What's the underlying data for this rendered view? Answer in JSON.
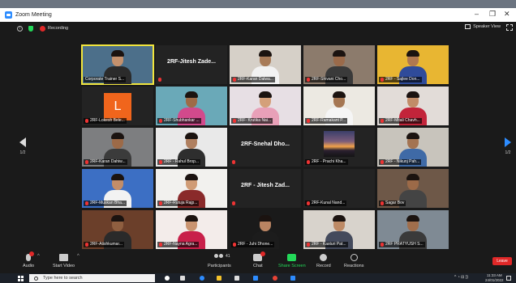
{
  "window": {
    "title": "Zoom Meeting",
    "minimize": "–",
    "maximize": "❐",
    "close": "✕"
  },
  "meeting_bar": {
    "recording": "Recording",
    "speaker_view": "Speaker View"
  },
  "nav": {
    "left_page": "1/2",
    "right_page": "1/2"
  },
  "tiles": [
    {
      "label": "Corporate Trainer S...",
      "big": "",
      "active": true,
      "kind": "photo",
      "bg": "#4c6f8a",
      "skin": "#c4916d",
      "shirt": "#2b2b2b",
      "hair": true
    },
    {
      "label": "",
      "big": "2RF-Jitesh Zade...",
      "kind": "name"
    },
    {
      "label": "2RF-Karan Dalwa...",
      "big": "",
      "kind": "photo",
      "bg": "#d6d0c8",
      "skin": "#a87b58",
      "shirt": "#f2f2f2",
      "hair": true
    },
    {
      "label": "2RF-Shivani Cho...",
      "big": "",
      "kind": "photo",
      "bg": "#8c7b6c",
      "skin": "#9a6a4a",
      "shirt": "#3a3a3a",
      "hair": true
    },
    {
      "label": "2RF - Sajlee Don...",
      "big": "",
      "kind": "photo",
      "bg": "#e8b632",
      "skin": "#b07850",
      "shirt": "#2f4b9a",
      "hair": true
    },
    {
      "label": "2RF-Lokesh Bele...",
      "big": "",
      "kind": "letter",
      "letter": "L"
    },
    {
      "label": "2RF-Shubhankar ...",
      "big": "",
      "kind": "photo",
      "bg": "#6aa9b8",
      "skin": "#9e6b47",
      "shirt": "#d24a8c",
      "hair": true
    },
    {
      "label": "2RF- Krutika Nai...",
      "big": "",
      "kind": "photo",
      "bg": "#e7dfe4",
      "skin": "#d4a07a",
      "shirt": "#e8a0b8",
      "hair": true
    },
    {
      "label": "2RF-Ramakant P...",
      "big": "",
      "kind": "photo",
      "bg": "#ece9e2",
      "skin": "#a57652",
      "shirt": "#f5f5f5",
      "hair": true
    },
    {
      "label": "2RF-Mitali Chavh...",
      "big": "",
      "kind": "photo",
      "bg": "#e2dcd8",
      "skin": "#c18c68",
      "shirt": "#c2243a",
      "hair": true
    },
    {
      "label": "2RF-Karan Dahiw...",
      "big": "",
      "kind": "photo",
      "bg": "#7d7e80",
      "skin": "#9c6a48",
      "shirt": "#3b3b3b",
      "hair": true
    },
    {
      "label": "2RF - Rahul Brop...",
      "big": "",
      "kind": "photo",
      "bg": "#e9e9e9",
      "skin": "#b08060",
      "shirt": "#2e2e2e",
      "hair": true
    },
    {
      "label": "",
      "big": "2RF-Snehal Dho...",
      "kind": "name"
    },
    {
      "label": "2RF - Prachi Kha...",
      "big": "",
      "kind": "sunset"
    },
    {
      "label": "2RF - Nikunj Pah...",
      "big": "",
      "kind": "photo",
      "bg": "#c8c4bc",
      "skin": "#a47452",
      "shirt": "#3f6aa6",
      "hair": true
    },
    {
      "label": "2RF-Muskan Bha...",
      "big": "",
      "kind": "photo",
      "bg": "#3c6fc4",
      "skin": "#c28d68",
      "shirt": "#f2f2f2",
      "hair": true
    },
    {
      "label": "2RF-Rutuja Rajp...",
      "big": "",
      "kind": "photo",
      "bg": "#f2f1ee",
      "skin": "#d09c76",
      "shirt": "#8a2a2a",
      "hair": true
    },
    {
      "label": "",
      "big": "2RF - Jitesh Zad...",
      "kind": "name"
    },
    {
      "label": "2RF-Kunal Nand...",
      "big": "",
      "kind": "blank"
    },
    {
      "label": "Sagar Bov",
      "big": "",
      "kind": "photo",
      "bg": "#6e5848",
      "skin": "#9c6a48",
      "shirt": "#444444",
      "hair": true
    },
    {
      "label": "2RF-Atishkumar...",
      "big": "",
      "kind": "photo",
      "bg": "#6b3f2a",
      "skin": "#8f5f40",
      "shirt": "#2a2a2a",
      "hair": true
    },
    {
      "label": "2RF-Nayna Agra...",
      "big": "",
      "kind": "photo",
      "bg": "#f3ecea",
      "skin": "#c99470",
      "shirt": "#c8204a",
      "hair": true
    },
    {
      "label": "2RF - Juhi Dhone...",
      "big": "",
      "kind": "photo",
      "bg": "#1a1a1a",
      "skin": "#b98462",
      "shirt": "#1c1c1c",
      "hair": true
    },
    {
      "label": "2RF - Kasturi Pat...",
      "big": "",
      "kind": "photo",
      "bg": "#d8d3cc",
      "skin": "#bd8a66",
      "shirt": "#444a5c",
      "hair": true
    },
    {
      "label": "2RF PRATYUSH S...",
      "big": "",
      "kind": "photo",
      "bg": "#7f8a94",
      "skin": "#a06e4c",
      "shirt": "#3a3a3a",
      "hair": true
    }
  ],
  "toolbar": {
    "audio": "Audio",
    "video": "Start Video",
    "participants": "Participants",
    "participants_count": "41",
    "chat": "Chat",
    "share": "Share Screen",
    "record": "Record",
    "reactions": "Reactions",
    "leave": "Leave"
  },
  "taskbar": {
    "search_placeholder": "Type here to search",
    "time": "11:33 AM",
    "date": "24/01/2022"
  }
}
